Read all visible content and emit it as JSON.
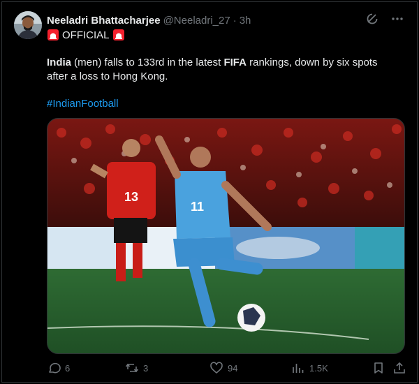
{
  "author": {
    "name": "Neeladri Bhattacharjee",
    "handle": "@Neeladri_27",
    "separator": "·",
    "time": "3h",
    "tagline": "OFFICIAL"
  },
  "post": {
    "segments": [
      {
        "text": "India",
        "bold": true
      },
      {
        "text": " (men) falls to 133rd in the latest ",
        "bold": false
      },
      {
        "text": "FIFA",
        "bold": true
      },
      {
        "text": " rankings, down by six spots after a loss to Hong Kong.",
        "bold": false
      }
    ],
    "hashtag": "#IndianFootball"
  },
  "media": {
    "player_numbers": {
      "front": "11",
      "back": "13"
    }
  },
  "actions": {
    "replies": "6",
    "reposts": "3",
    "likes": "94",
    "views": "1.5K"
  },
  "colors": {
    "background": "#000000",
    "text": "#e7e9ea",
    "muted": "#71767b",
    "link": "#1d9bf0",
    "border": "#2f3336",
    "siren": "#f4212e"
  },
  "icons": [
    "grok-icon",
    "more-icon",
    "siren-icon",
    "reply-icon",
    "repost-icon",
    "like-icon",
    "views-icon",
    "bookmark-icon",
    "share-icon"
  ]
}
